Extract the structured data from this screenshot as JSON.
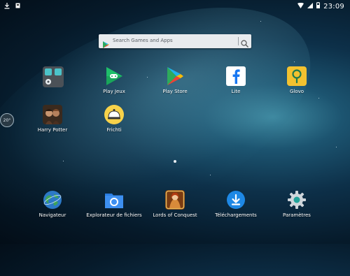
{
  "status_bar": {
    "time": "23:09"
  },
  "search": {
    "placeholder": "Search Games and Apps"
  },
  "apps": {
    "folder": "",
    "play_jeux": "Play Jeux",
    "play_store": "Play Store",
    "lite": "Lite",
    "glovo": "Glovo",
    "harry_potter": "Harry Potter",
    "frichti": "Frichti"
  },
  "dock": {
    "navigateur": "Navigateur",
    "explorateur": "Explorateur de fichiers",
    "lords": "Lords of Conquest",
    "telechargements": "Téléchargements",
    "parametres": "Paramètres"
  },
  "side_badge": "20°",
  "colors": {
    "glovo_yellow": "#f2c230",
    "facebook_blue": "#1877f2",
    "play_green": "#19a65a",
    "download_blue": "#1e88e5",
    "folder_blue": "#2a7de1",
    "frichti_yellow": "#f7d24a"
  }
}
